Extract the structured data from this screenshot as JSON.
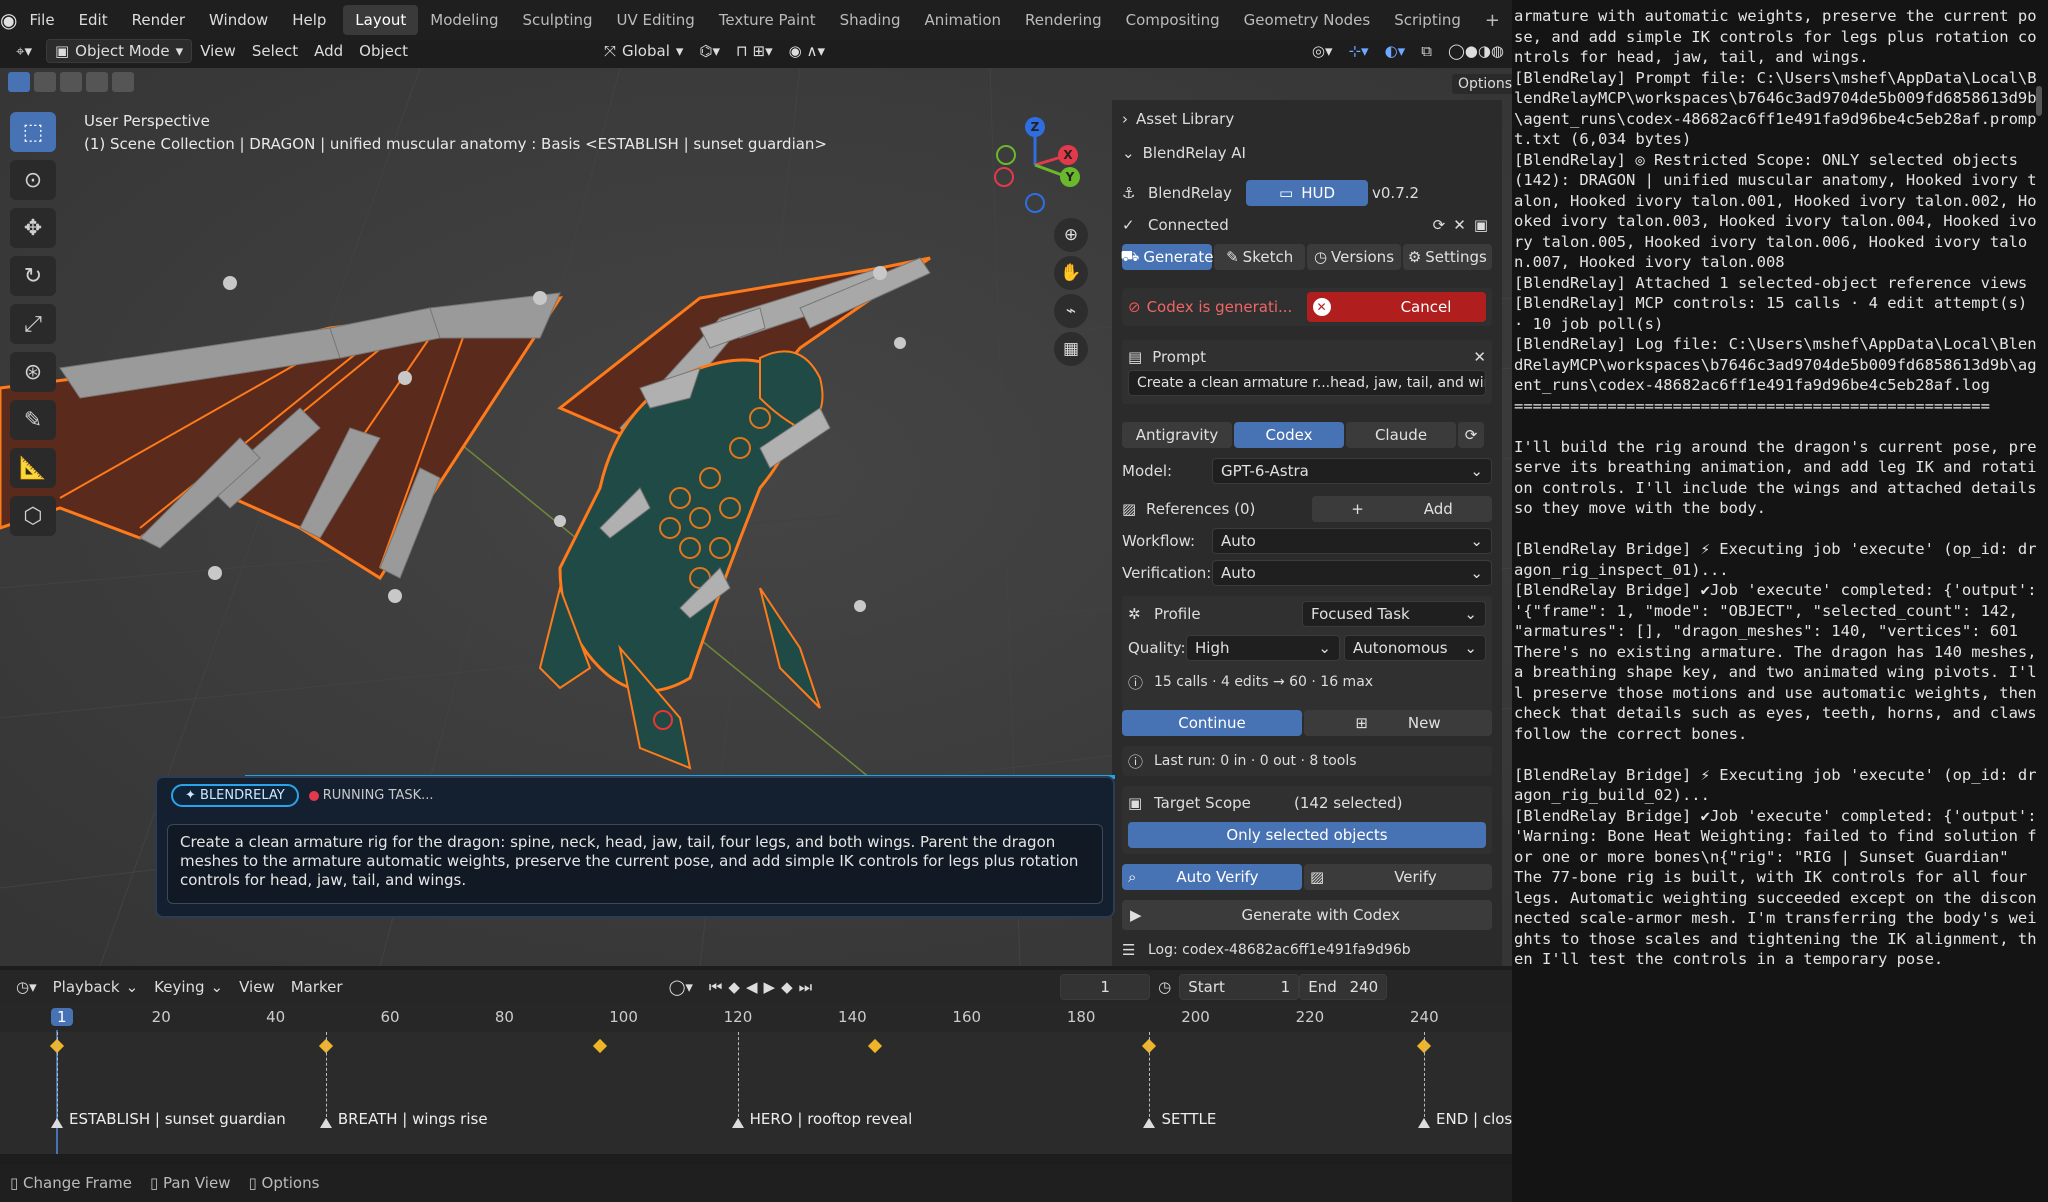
{
  "menus": [
    "File",
    "Edit",
    "Render",
    "Window",
    "Help"
  ],
  "workspaces": [
    "Layout",
    "Modeling",
    "Sculpting",
    "UV Editing",
    "Texture Paint",
    "Shading",
    "Animation",
    "Rendering",
    "Compositing",
    "Geometry Nodes",
    "Scripting"
  ],
  "active_workspace": "Layout",
  "header": {
    "mode": "Object Mode",
    "view_menu": [
      "View",
      "Select",
      "Add",
      "Object"
    ],
    "orientation": "Global",
    "options": "Options"
  },
  "viewport": {
    "perspective": "User Perspective",
    "scene_path": "(1) Scene Collection | DRAGON | unified muscular anatomy : Basis <ESTABLISH | sunset guardian>",
    "gizmo": {
      "x": "X",
      "y": "Y",
      "z": "Z"
    }
  },
  "sidebar": {
    "asset_library": "Asset Library",
    "panel_title": "BlendRelay AI",
    "app_name": "BlendRelay",
    "hud_label": "HUD",
    "version": "v0.7.2",
    "connected": "Connected",
    "tabs": [
      "Generate",
      "Sketch",
      "Versions",
      "Settings"
    ],
    "status_text": "Codex is generati...",
    "cancel": "Cancel",
    "prompt_label": "Prompt",
    "prompt_value": "Create a clean armature r...head, jaw, tail, and wings.",
    "providers": [
      "Antigravity",
      "Codex",
      "Claude"
    ],
    "model_label": "Model:",
    "model_value": "GPT-6-Astra",
    "references_label": "References (0)",
    "add_label": "Add",
    "workflow_label": "Workflow:",
    "workflow_value": "Auto",
    "verification_label": "Verification:",
    "verification_value": "Auto",
    "profile_label": "Profile",
    "profile_value": "Focused Task",
    "quality_label": "Quality:",
    "quality_value": "High",
    "autonomy_value": "Autonomous",
    "calls_info": "15 calls · 4 edits → 60 · 16 max",
    "continue_label": "Continue",
    "new_label": "New",
    "last_run": "Last run: 0 in · 0 out · 8 tools",
    "target_scope_label": "Target Scope",
    "target_scope_value": "(142 selected)",
    "only_selected": "Only selected objects",
    "auto_verify": "Auto Verify",
    "verify": "Verify",
    "generate_with": "Generate with Codex",
    "log_label": "Log: codex-48682ac6ff1e491fa9d96b"
  },
  "overlay": {
    "badge": "✦ BLENDRELAY",
    "status": "RUNNING TASK...",
    "text": "Create a clean armature rig for the dragon: spine, neck, head, jaw, tail, four legs, and both wings. Parent the dragon meshes to the armature automatic weights, preserve the current pose, and add simple IK controls for legs plus rotation controls for head, jaw, tail, and wings."
  },
  "timeline": {
    "menus": [
      "Playback",
      "Keying",
      "View",
      "Marker"
    ],
    "current_frame": "1",
    "start_label": "Start",
    "start_value": "1",
    "end_label": "End",
    "end_value": "240",
    "ticks": [
      "1",
      "20",
      "40",
      "60",
      "80",
      "100",
      "120",
      "140",
      "160",
      "180",
      "200",
      "220",
      "240"
    ],
    "markers": [
      {
        "frame": 1,
        "label": "ESTABLISH | sunset guardian"
      },
      {
        "frame": 48,
        "label": "BREATH | wings rise"
      },
      {
        "frame": 120,
        "label": "HERO | rooftop reveal"
      },
      {
        "frame": 192,
        "label": "SETTLE"
      },
      {
        "frame": 240,
        "label": "END | close"
      }
    ],
    "keyframes": [
      1,
      48,
      96,
      144,
      192,
      240
    ]
  },
  "statusbar": [
    "Change Frame",
    "Pan View",
    "Options"
  ],
  "console_lines": [
    "armature with automatic weights, preserve the current pose, and add simple IK controls for legs plus rotation controls for head, jaw, tail, and wings.",
    "[BlendRelay] Prompt file: C:\\Users\\mshef\\AppData\\Local\\BlendRelayMCP\\workspaces\\b7646c3ad9704de5b009fd6858613d9b\\agent_runs\\codex-48682ac6ff1e491fa9d96be4c5eb28af.prompt.txt (6,034 bytes)",
    "[BlendRelay] ◎ Restricted Scope: ONLY selected objects (142): DRAGON | unified muscular anatomy, Hooked ivory talon, Hooked ivory talon.001, Hooked ivory talon.002, Hooked ivory talon.003, Hooked ivory talon.004, Hooked ivory talon.005, Hooked ivory talon.006, Hooked ivory talon.007, Hooked ivory talon.008",
    "[BlendRelay] Attached 1 selected-object reference views",
    "[BlendRelay] MCP controls: 15 calls · 4 edit attempt(s) · 10 job poll(s)",
    "[BlendRelay] Log file: C:\\Users\\mshef\\AppData\\Local\\BlendRelayMCP\\workspaces\\b7646c3ad9704de5b009fd6858613d9b\\agent_runs\\codex-48682ac6ff1e491fa9d96be4c5eb28af.log",
    "===================================================",
    "",
    "I'll build the rig around the dragon's current pose, preserve its breathing animation, and add leg IK and rotation controls. I'll include the wings and attached details so they move with the body.",
    "",
    "[BlendRelay Bridge] ⚡ Executing job 'execute' (op_id: dragon_rig_inspect_01)...",
    "[BlendRelay Bridge] ✔Job 'execute' completed: {'output': '{\"frame\": 1, \"mode\": \"OBJECT\", \"selected_count\": 142, \"armatures\": [], \"dragon_meshes\": 140, \"vertices\": 601",
    "There's no existing armature. The dragon has 140 meshes, a breathing shape key, and two animated wing pivots. I'll preserve those motions and use automatic weights, then check that details such as eyes, teeth, horns, and claws follow the correct bones.",
    "",
    "[BlendRelay Bridge] ⚡ Executing job 'execute' (op_id: dragon_rig_build_02)...",
    "[BlendRelay Bridge] ✔Job 'execute' completed: {'output': 'Warning: Bone Heat Weighting: failed to find solution for one or more bones\\n{\"rig\": \"RIG | Sunset Guardian\"",
    "The 77-bone rig is built, with IK controls for all four legs. Automatic weighting succeeded except on the disconnected scale-armor mesh. I'm transferring the body's weights to those scales and tightening the IK alignment, then I'll test the controls in a temporary pose."
  ]
}
